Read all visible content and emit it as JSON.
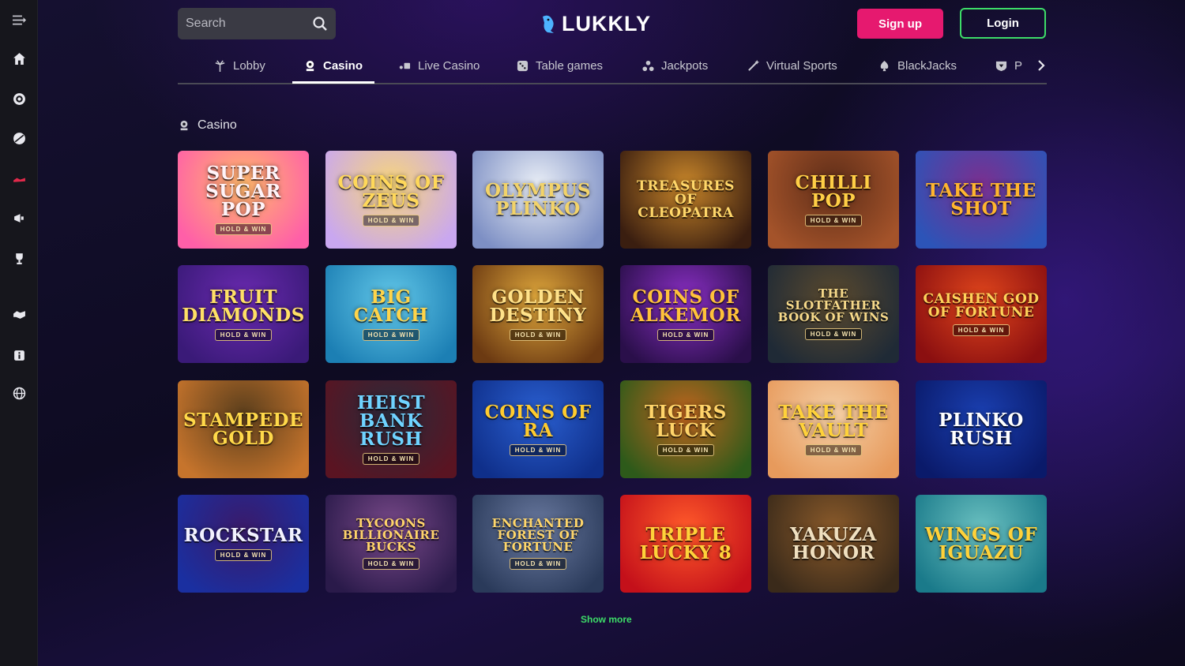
{
  "header": {
    "search_placeholder": "Search",
    "logo_text": "LUKKLY",
    "signup_label": "Sign up",
    "login_label": "Login"
  },
  "sidebar": {
    "items": [
      {
        "icon": "menu-collapse-icon"
      },
      {
        "icon": "home-icon"
      },
      {
        "icon": "slot-reel-icon"
      },
      {
        "icon": "sports-ball-icon"
      },
      {
        "icon": "live-shoe-icon"
      },
      {
        "icon": "megaphone-icon"
      },
      {
        "icon": "trophy-icon"
      },
      {
        "icon": "handshake-icon"
      },
      {
        "icon": "info-icon"
      },
      {
        "icon": "globe-icon"
      }
    ]
  },
  "tabs": [
    {
      "label": "Lobby",
      "icon": "palm-icon"
    },
    {
      "label": "Casino",
      "icon": "casino-chip-icon",
      "active": true
    },
    {
      "label": "Live Casino",
      "icon": "live-cards-icon"
    },
    {
      "label": "Table games",
      "icon": "dice-icon"
    },
    {
      "label": "Jackpots",
      "icon": "jackpot-icon"
    },
    {
      "label": "Virtual Sports",
      "icon": "wand-icon"
    },
    {
      "label": "BlackJacks",
      "icon": "spade-icon"
    },
    {
      "label": "P",
      "icon": "shield-icon"
    }
  ],
  "section": {
    "title": "Casino",
    "show_more_label": "Show more"
  },
  "games": [
    {
      "title": "SUPER SUGAR POP",
      "badge": "HOLD & WIN",
      "bg": [
        "#ff5fa8",
        "#ffb86b"
      ],
      "fg": "#fff3f8"
    },
    {
      "title": "COINS OF ZEUS",
      "badge": "HOLD & WIN",
      "bg": [
        "#c9a7f0",
        "#f7d57a"
      ],
      "fg": "#ffd85a"
    },
    {
      "title": "OLYMPUS PLINKO",
      "badge": "",
      "bg": [
        "#7d8fc4",
        "#e9eef6"
      ],
      "fg": "#f2d36a"
    },
    {
      "title": "TREASURES OF CLEOPATRA",
      "badge": "",
      "bg": [
        "#3a1e10",
        "#c8862a"
      ],
      "fg": "#ffd76a"
    },
    {
      "title": "CHILLI POP",
      "badge": "HOLD & WIN",
      "bg": [
        "#a4532a",
        "#5e2d18"
      ],
      "fg": "#ffcf46"
    },
    {
      "title": "TAKE THE SHOT",
      "badge": "",
      "bg": [
        "#2c54b8",
        "#7b2f8f"
      ],
      "fg": "#ffb52e"
    },
    {
      "title": "FRUIT DIAMONDS",
      "badge": "HOLD & WIN",
      "bg": [
        "#3a1a78",
        "#6a2ab0"
      ],
      "fg": "#ffe066"
    },
    {
      "title": "BIG CATCH",
      "badge": "HOLD & WIN",
      "bg": [
        "#1c7fb4",
        "#62c7e8"
      ],
      "fg": "#ffd44a"
    },
    {
      "title": "GOLDEN DESTINY",
      "badge": "HOLD & WIN",
      "bg": [
        "#6c3a12",
        "#e0a83c"
      ],
      "fg": "#ffe28a"
    },
    {
      "title": "COINS OF ALKEMOR",
      "badge": "HOLD & WIN",
      "bg": [
        "#2a0f4a",
        "#8a2fc4"
      ],
      "fg": "#ffc23a"
    },
    {
      "title": "THE SLOTFATHER BOOK OF WINS",
      "badge": "HOLD & WIN",
      "bg": [
        "#1f2a36",
        "#5b4a2e"
      ],
      "fg": "#f6d98a"
    },
    {
      "title": "CAISHEN GOD OF FORTUNE",
      "badge": "HOLD & WIN",
      "bg": [
        "#8b0f10",
        "#e0461c"
      ],
      "fg": "#ffd35a"
    },
    {
      "title": "STAMPEDE GOLD",
      "badge": "",
      "bg": [
        "#c6742c",
        "#5a3e1c"
      ],
      "fg": "#ffd94a"
    },
    {
      "title": "HEIST BANK RUSH",
      "badge": "HOLD & WIN",
      "bg": [
        "#5a1422",
        "#2a2a3a"
      ],
      "fg": "#6fd3ff"
    },
    {
      "title": "COINS OF RA",
      "badge": "HOLD & WIN",
      "bg": [
        "#0f2f8a",
        "#2a5fd0"
      ],
      "fg": "#ffcb2e"
    },
    {
      "title": "TIGERS LUCK",
      "badge": "HOLD & WIN",
      "bg": [
        "#2d5a1a",
        "#c0641e"
      ],
      "fg": "#ffd46a"
    },
    {
      "title": "TAKE THE VAULT",
      "badge": "HOLD & WIN",
      "bg": [
        "#e79a5c",
        "#f4cfa6"
      ],
      "fg": "#ffd23a"
    },
    {
      "title": "PLINKO RUSH",
      "badge": "",
      "bg": [
        "#0a1a6a",
        "#1a3fb0"
      ],
      "fg": "#ffffff"
    },
    {
      "title": "ROCKSTAR",
      "badge": "HOLD & WIN",
      "bg": [
        "#1a2fa0",
        "#3a1a6a"
      ],
      "fg": "#f2f2ff"
    },
    {
      "title": "TYCOONS BILLIONAIRE BUCKS",
      "badge": "HOLD & WIN",
      "bg": [
        "#2a1a4a",
        "#7a4a8a"
      ],
      "fg": "#ffd46a"
    },
    {
      "title": "ENCHANTED FOREST OF FORTUNE",
      "badge": "HOLD & WIN",
      "bg": [
        "#2a3a5a",
        "#6a7aa0"
      ],
      "fg": "#ffd66a"
    },
    {
      "title": "TRIPLE LUCKY 8",
      "badge": "",
      "bg": [
        "#c4101a",
        "#ff5a2a"
      ],
      "fg": "#ffd23a"
    },
    {
      "title": "YAKUZA HONOR",
      "badge": "",
      "bg": [
        "#3a2a1a",
        "#8a5a2a"
      ],
      "fg": "#f0e0c0"
    },
    {
      "title": "WINGS OF IGUAZU",
      "badge": "",
      "bg": [
        "#1a7a8a",
        "#6ac0c0"
      ],
      "fg": "#ffd23a"
    }
  ],
  "colors": {
    "accent_pink": "#e6196f",
    "accent_green": "#3ddc68",
    "sidebar_bg": "#16161c"
  }
}
